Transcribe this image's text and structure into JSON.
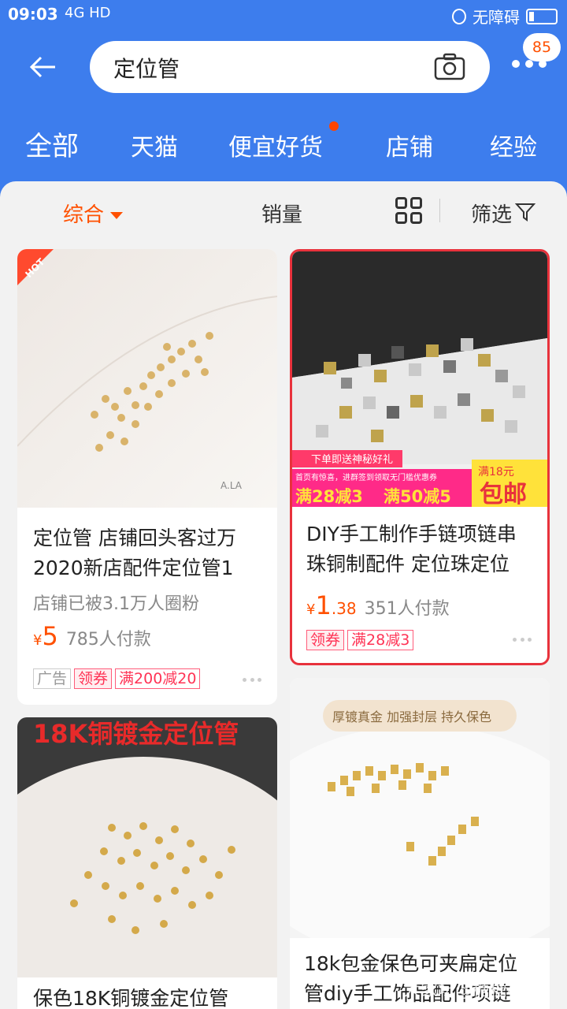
{
  "status": {
    "time": "09:03",
    "network": "4G HD",
    "accessibility": "无障碍"
  },
  "search": {
    "query": "定位管",
    "badge": "85"
  },
  "tabs": [
    {
      "label": "全部"
    },
    {
      "label": "天猫"
    },
    {
      "label": "便宜好货"
    },
    {
      "label": "店铺"
    },
    {
      "label": "经验"
    }
  ],
  "sort": {
    "composite": "综合",
    "sales": "销量",
    "filter": "筛选"
  },
  "products": [
    {
      "title": "定位管 店铺回头客过万2020新店配件定位管1",
      "sub": "店铺已被3.1万人圈粉",
      "price_symbol": "¥",
      "price_int": "5",
      "price_dec": "",
      "paid": "785人付款",
      "tags": {
        "ad": "广告",
        "coupon": "领券",
        "discount": "满200减20"
      },
      "hot_badge": "HOT",
      "image_brand": "A.LA"
    },
    {
      "title": "DIY手工制作手链项链串珠铜制配件 定位珠定位",
      "price_symbol": "¥",
      "price_int": "1",
      "price_dec": ".38",
      "paid": "351人付款",
      "tags": {
        "coupon": "领券",
        "discount": "满28减3"
      },
      "banner": {
        "gift": "下单即送神秘好礼",
        "note": "首页有惊喜，进群签到领取无门槛优惠券",
        "offer1": "满28减3",
        "offer2": "满50减5",
        "threshold": "满18元",
        "free": "包邮"
      }
    },
    {
      "image_title": "18K铜镀金定位管",
      "title": "保色18K铜镀金定位管"
    },
    {
      "image_tag": "厚镀真金 加强封层 持久保色",
      "title": "18k包金保色可夹扁定位管diy手工饰品配件项链"
    }
  ],
  "watermark": "大家坛@糖糖桃子",
  "colors": {
    "header": "#3d7ded",
    "accent": "#ff5000",
    "coupon": "#ff3355"
  }
}
